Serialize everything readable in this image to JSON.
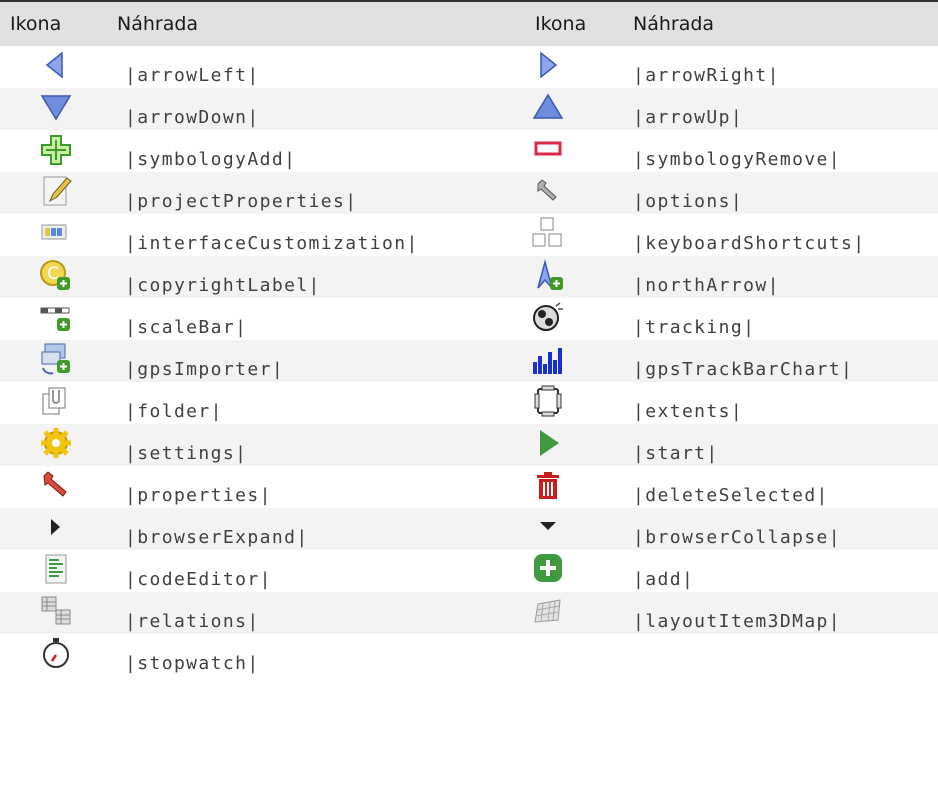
{
  "table": {
    "headers": {
      "icon1": "Ikona",
      "sub1": "Náhrada",
      "icon2": "Ikona",
      "sub2": "Náhrada"
    },
    "rows": [
      {
        "left": {
          "icon": "arrow-left-icon",
          "text": "|arrowLeft|"
        },
        "right": {
          "icon": "arrow-right-icon",
          "text": "|arrowRight|"
        }
      },
      {
        "left": {
          "icon": "arrow-down-icon",
          "text": "|arrowDown|"
        },
        "right": {
          "icon": "arrow-up-icon",
          "text": "|arrowUp|"
        }
      },
      {
        "left": {
          "icon": "symbology-add-icon",
          "text": "|symbologyAdd|"
        },
        "right": {
          "icon": "symbology-remove-icon",
          "text": "|symbologyRemove|"
        }
      },
      {
        "left": {
          "icon": "project-properties-icon",
          "text": "|projectProperties|"
        },
        "right": {
          "icon": "options-wrench-icon",
          "text": "|options|"
        }
      },
      {
        "left": {
          "icon": "interface-customization-icon",
          "text": "|interfaceCustomization|"
        },
        "right": {
          "icon": "keyboard-shortcuts-icon",
          "text": "|keyboardShortcuts|"
        }
      },
      {
        "left": {
          "icon": "copyright-label-icon",
          "text": "|copyrightLabel|"
        },
        "right": {
          "icon": "north-arrow-icon",
          "text": "|northArrow|"
        }
      },
      {
        "left": {
          "icon": "scale-bar-icon",
          "text": "|scaleBar|"
        },
        "right": {
          "icon": "tracking-icon",
          "text": "|tracking|"
        }
      },
      {
        "left": {
          "icon": "gps-importer-icon",
          "text": "|gpsImporter|"
        },
        "right": {
          "icon": "gps-track-bar-chart-icon",
          "text": "|gpsTrackBarChart|"
        }
      },
      {
        "left": {
          "icon": "folder-icon",
          "text": "|folder|"
        },
        "right": {
          "icon": "extents-icon",
          "text": "|extents|"
        }
      },
      {
        "left": {
          "icon": "settings-gear-icon",
          "text": "|settings|"
        },
        "right": {
          "icon": "start-play-icon",
          "text": "|start|"
        }
      },
      {
        "left": {
          "icon": "properties-wrench-icon",
          "text": "|properties|"
        },
        "right": {
          "icon": "delete-selected-icon",
          "text": "|deleteSelected|"
        }
      },
      {
        "left": {
          "icon": "browser-expand-icon",
          "text": "|browserExpand|"
        },
        "right": {
          "icon": "browser-collapse-icon",
          "text": "|browserCollapse|"
        }
      },
      {
        "left": {
          "icon": "code-editor-icon",
          "text": "|codeEditor|"
        },
        "right": {
          "icon": "add-icon",
          "text": "|add|"
        }
      },
      {
        "left": {
          "icon": "relations-icon",
          "text": "|relations|"
        },
        "right": {
          "icon": "layout-item-3d-map-icon",
          "text": "|layoutItem3DMap|"
        }
      },
      {
        "left": {
          "icon": "stopwatch-icon",
          "text": "|stopwatch|"
        },
        "right": null
      }
    ]
  }
}
